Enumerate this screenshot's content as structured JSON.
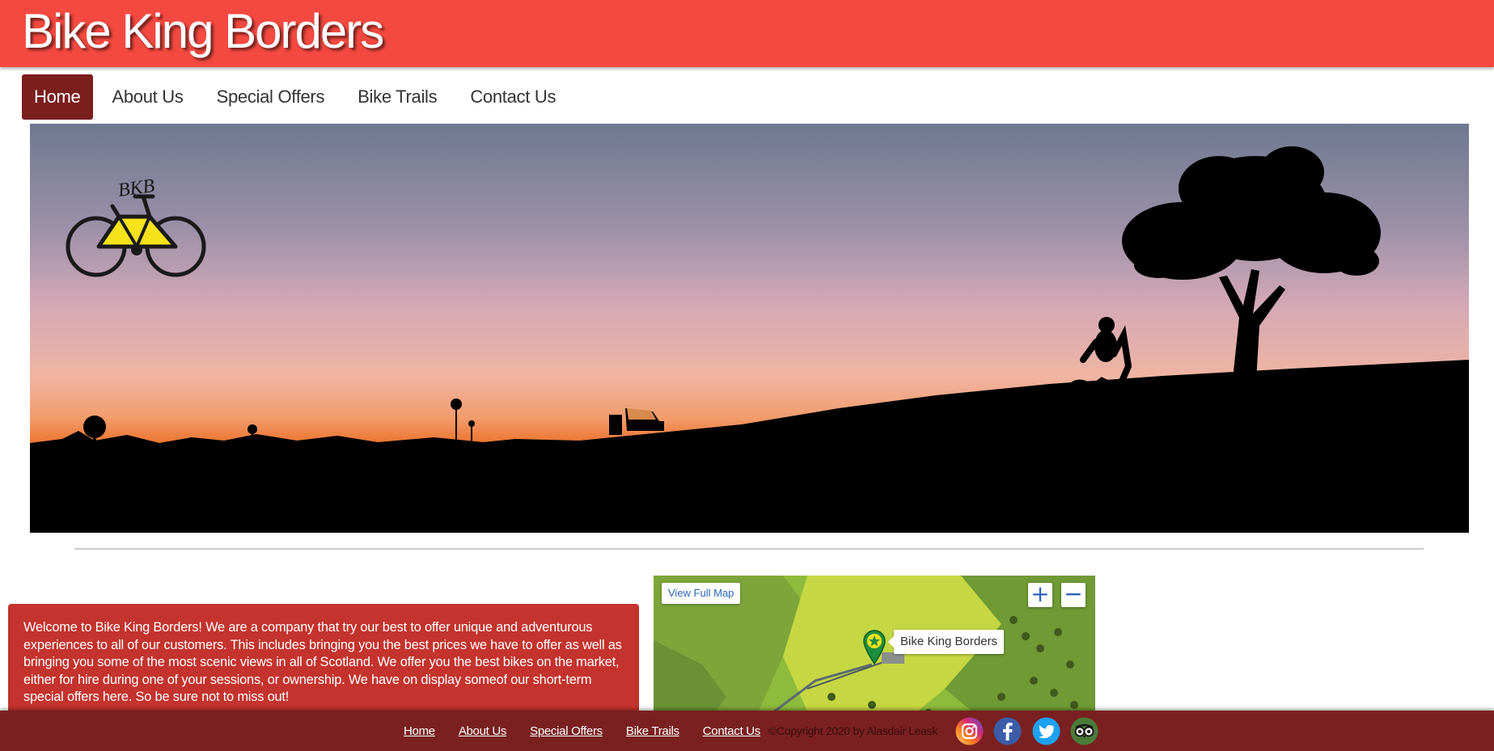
{
  "site": {
    "title": "Bike King Borders"
  },
  "nav": {
    "items": [
      {
        "label": "Home",
        "active": true
      },
      {
        "label": "About Us",
        "active": false
      },
      {
        "label": "Special Offers",
        "active": false
      },
      {
        "label": "Bike Trails",
        "active": false
      },
      {
        "label": "Contact Us",
        "active": false
      }
    ]
  },
  "hero": {
    "logo_text": "BKB"
  },
  "welcome": {
    "text": "Welcome to Bike King Borders! We are a company that try our best to offer unique and adventurous experiences to all of our customers. This includes bringing you the best prices we have to offer as well as bringing you some of the most scenic views in all of Scotland. We offer you the best bikes on the market, either for hire during one of your sessions, or ownership. We have on display someof our short-term special offers here. So be sure not to miss out!"
  },
  "map": {
    "view_full_map": "View Full Map",
    "zoom_in": "+",
    "zoom_out": "−",
    "location_label": "Bike King Borders"
  },
  "footer": {
    "links": [
      "Home",
      "About Us",
      "Special Offers",
      "Bike Trails",
      "Contact Us"
    ],
    "copyright": "©Copyright 2020 by Alasdair Leask",
    "social": [
      "instagram-icon",
      "facebook-icon",
      "twitter-icon",
      "tripadvisor-icon"
    ]
  },
  "colors": {
    "header_bg": "#f44940",
    "nav_active_bg": "#7a1e1e",
    "welcome_bg": "#c4332d",
    "footer_bg": "#7a2020"
  }
}
